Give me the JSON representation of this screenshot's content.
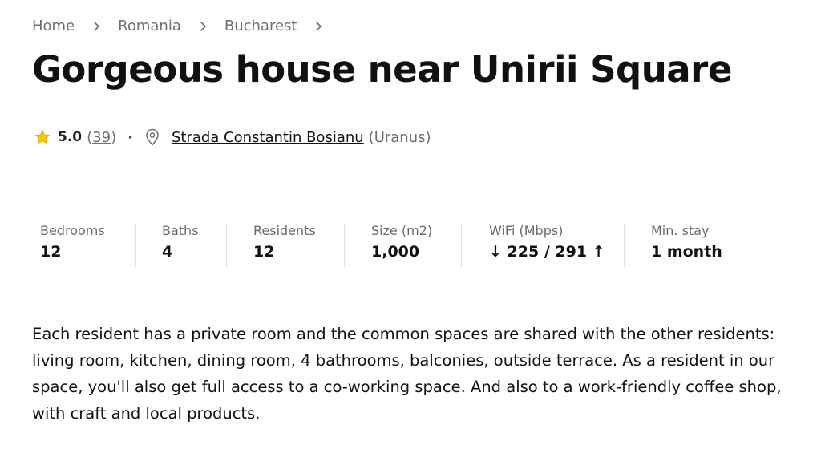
{
  "breadcrumb": {
    "items": [
      {
        "label": "Home"
      },
      {
        "label": "Romania"
      },
      {
        "label": "Bucharest"
      }
    ]
  },
  "listing": {
    "title": "Gorgeous house near Unirii Square",
    "rating": "5.0",
    "review_count": "39",
    "separator": "·",
    "street": "Strada Constantin Bosianu",
    "district": "(Uranus)"
  },
  "stats": [
    {
      "label": "Bedrooms",
      "value": "12"
    },
    {
      "label": "Baths",
      "value": "4"
    },
    {
      "label": "Residents",
      "value": "12"
    },
    {
      "label": "Size (m2)",
      "value": "1,000"
    },
    {
      "label": "WiFi (Mbps)",
      "value": "225 / 291",
      "down_arrow": "↓",
      "up_arrow": "↑"
    },
    {
      "label": "Min. stay",
      "value": "1 month"
    }
  ],
  "description": "Each resident has a private room and the common spaces are shared with the other residents: living room, kitchen, dining room, 4 bathrooms, balconies, outside terrace. As a resident in our space, you'll also get full access to a co-working space. And also to a work-friendly coffee shop, with craft and local products.",
  "colors": {
    "star": "#f5c518",
    "muted": "#6f6f6f",
    "divider": "#e2e2e2"
  },
  "icons": {
    "rating": "star-icon",
    "location": "map-pin-icon",
    "breadcrumb_separator": "chevron-right-icon"
  }
}
